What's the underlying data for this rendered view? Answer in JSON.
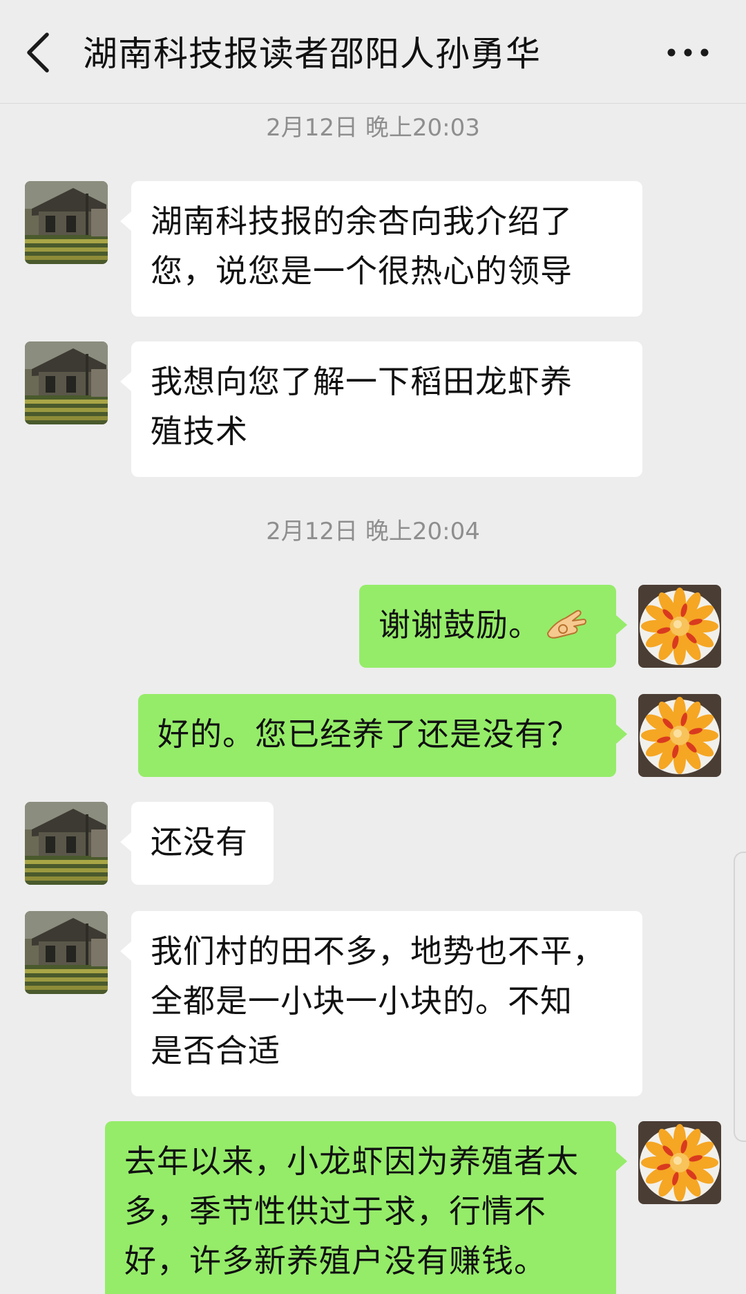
{
  "header": {
    "title": "湖南科技报读者邵阳人孙勇华",
    "back_icon": "chevron-left-icon",
    "more_icon": "more-horizontal-icon"
  },
  "colors": {
    "background": "#ededed",
    "incoming_bubble": "#ffffff",
    "outgoing_bubble": "#95ec69",
    "timestamp_text": "#8e8e8e"
  },
  "timestamps": [
    "2月12日 晚上20:03",
    "2月12日 晚上20:04"
  ],
  "messages": [
    {
      "side": "left",
      "lines": [
        "湖南科技报的余杏向我介绍了",
        "您，说您是一个很热心的领导"
      ]
    },
    {
      "side": "left",
      "lines": [
        "我想向您了解一下稻田龙虾养",
        "殖技术"
      ]
    },
    {
      "side": "right",
      "lines": [
        "谢谢鼓励。"
      ],
      "emoji": "ok-hand-emoji"
    },
    {
      "side": "right",
      "lines": [
        "好的。您已经养了还是没有？"
      ]
    },
    {
      "side": "left",
      "lines": [
        "还没有"
      ]
    },
    {
      "side": "left",
      "lines": [
        "我们村的田不多，地势也不平，",
        "全都是一小块一小块的。不知",
        "是否合适"
      ]
    },
    {
      "side": "right",
      "lines": [
        "去年以来，小龙虾因为养殖者太",
        "多，季节性供过于求，行情不",
        "好，许多新养殖户没有赚钱。"
      ]
    }
  ]
}
